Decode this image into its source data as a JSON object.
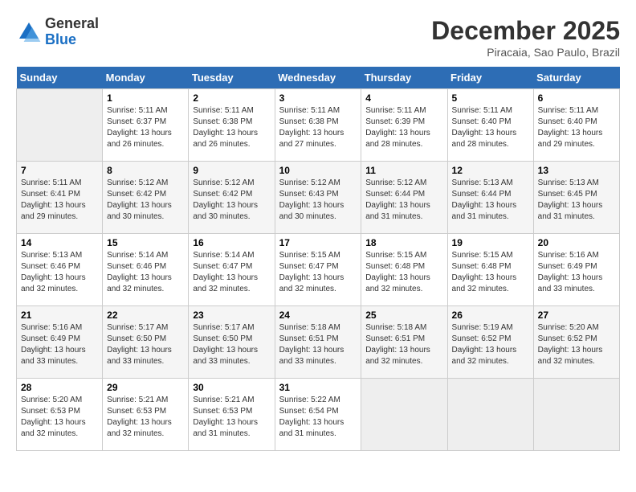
{
  "header": {
    "logo_line1": "General",
    "logo_line2": "Blue",
    "month": "December 2025",
    "location": "Piracaia, Sao Paulo, Brazil"
  },
  "weekdays": [
    "Sunday",
    "Monday",
    "Tuesday",
    "Wednesday",
    "Thursday",
    "Friday",
    "Saturday"
  ],
  "weeks": [
    [
      {
        "day": "",
        "info": ""
      },
      {
        "day": "1",
        "info": "Sunrise: 5:11 AM\nSunset: 6:37 PM\nDaylight: 13 hours\nand 26 minutes."
      },
      {
        "day": "2",
        "info": "Sunrise: 5:11 AM\nSunset: 6:38 PM\nDaylight: 13 hours\nand 26 minutes."
      },
      {
        "day": "3",
        "info": "Sunrise: 5:11 AM\nSunset: 6:38 PM\nDaylight: 13 hours\nand 27 minutes."
      },
      {
        "day": "4",
        "info": "Sunrise: 5:11 AM\nSunset: 6:39 PM\nDaylight: 13 hours\nand 28 minutes."
      },
      {
        "day": "5",
        "info": "Sunrise: 5:11 AM\nSunset: 6:40 PM\nDaylight: 13 hours\nand 28 minutes."
      },
      {
        "day": "6",
        "info": "Sunrise: 5:11 AM\nSunset: 6:40 PM\nDaylight: 13 hours\nand 29 minutes."
      }
    ],
    [
      {
        "day": "7",
        "info": "Sunrise: 5:11 AM\nSunset: 6:41 PM\nDaylight: 13 hours\nand 29 minutes."
      },
      {
        "day": "8",
        "info": "Sunrise: 5:12 AM\nSunset: 6:42 PM\nDaylight: 13 hours\nand 30 minutes."
      },
      {
        "day": "9",
        "info": "Sunrise: 5:12 AM\nSunset: 6:42 PM\nDaylight: 13 hours\nand 30 minutes."
      },
      {
        "day": "10",
        "info": "Sunrise: 5:12 AM\nSunset: 6:43 PM\nDaylight: 13 hours\nand 30 minutes."
      },
      {
        "day": "11",
        "info": "Sunrise: 5:12 AM\nSunset: 6:44 PM\nDaylight: 13 hours\nand 31 minutes."
      },
      {
        "day": "12",
        "info": "Sunrise: 5:13 AM\nSunset: 6:44 PM\nDaylight: 13 hours\nand 31 minutes."
      },
      {
        "day": "13",
        "info": "Sunrise: 5:13 AM\nSunset: 6:45 PM\nDaylight: 13 hours\nand 31 minutes."
      }
    ],
    [
      {
        "day": "14",
        "info": "Sunrise: 5:13 AM\nSunset: 6:46 PM\nDaylight: 13 hours\nand 32 minutes."
      },
      {
        "day": "15",
        "info": "Sunrise: 5:14 AM\nSunset: 6:46 PM\nDaylight: 13 hours\nand 32 minutes."
      },
      {
        "day": "16",
        "info": "Sunrise: 5:14 AM\nSunset: 6:47 PM\nDaylight: 13 hours\nand 32 minutes."
      },
      {
        "day": "17",
        "info": "Sunrise: 5:15 AM\nSunset: 6:47 PM\nDaylight: 13 hours\nand 32 minutes."
      },
      {
        "day": "18",
        "info": "Sunrise: 5:15 AM\nSunset: 6:48 PM\nDaylight: 13 hours\nand 32 minutes."
      },
      {
        "day": "19",
        "info": "Sunrise: 5:15 AM\nSunset: 6:48 PM\nDaylight: 13 hours\nand 32 minutes."
      },
      {
        "day": "20",
        "info": "Sunrise: 5:16 AM\nSunset: 6:49 PM\nDaylight: 13 hours\nand 33 minutes."
      }
    ],
    [
      {
        "day": "21",
        "info": "Sunrise: 5:16 AM\nSunset: 6:49 PM\nDaylight: 13 hours\nand 33 minutes."
      },
      {
        "day": "22",
        "info": "Sunrise: 5:17 AM\nSunset: 6:50 PM\nDaylight: 13 hours\nand 33 minutes."
      },
      {
        "day": "23",
        "info": "Sunrise: 5:17 AM\nSunset: 6:50 PM\nDaylight: 13 hours\nand 33 minutes."
      },
      {
        "day": "24",
        "info": "Sunrise: 5:18 AM\nSunset: 6:51 PM\nDaylight: 13 hours\nand 33 minutes."
      },
      {
        "day": "25",
        "info": "Sunrise: 5:18 AM\nSunset: 6:51 PM\nDaylight: 13 hours\nand 32 minutes."
      },
      {
        "day": "26",
        "info": "Sunrise: 5:19 AM\nSunset: 6:52 PM\nDaylight: 13 hours\nand 32 minutes."
      },
      {
        "day": "27",
        "info": "Sunrise: 5:20 AM\nSunset: 6:52 PM\nDaylight: 13 hours\nand 32 minutes."
      }
    ],
    [
      {
        "day": "28",
        "info": "Sunrise: 5:20 AM\nSunset: 6:53 PM\nDaylight: 13 hours\nand 32 minutes."
      },
      {
        "day": "29",
        "info": "Sunrise: 5:21 AM\nSunset: 6:53 PM\nDaylight: 13 hours\nand 32 minutes."
      },
      {
        "day": "30",
        "info": "Sunrise: 5:21 AM\nSunset: 6:53 PM\nDaylight: 13 hours\nand 31 minutes."
      },
      {
        "day": "31",
        "info": "Sunrise: 5:22 AM\nSunset: 6:54 PM\nDaylight: 13 hours\nand 31 minutes."
      },
      {
        "day": "",
        "info": ""
      },
      {
        "day": "",
        "info": ""
      },
      {
        "day": "",
        "info": ""
      }
    ]
  ]
}
